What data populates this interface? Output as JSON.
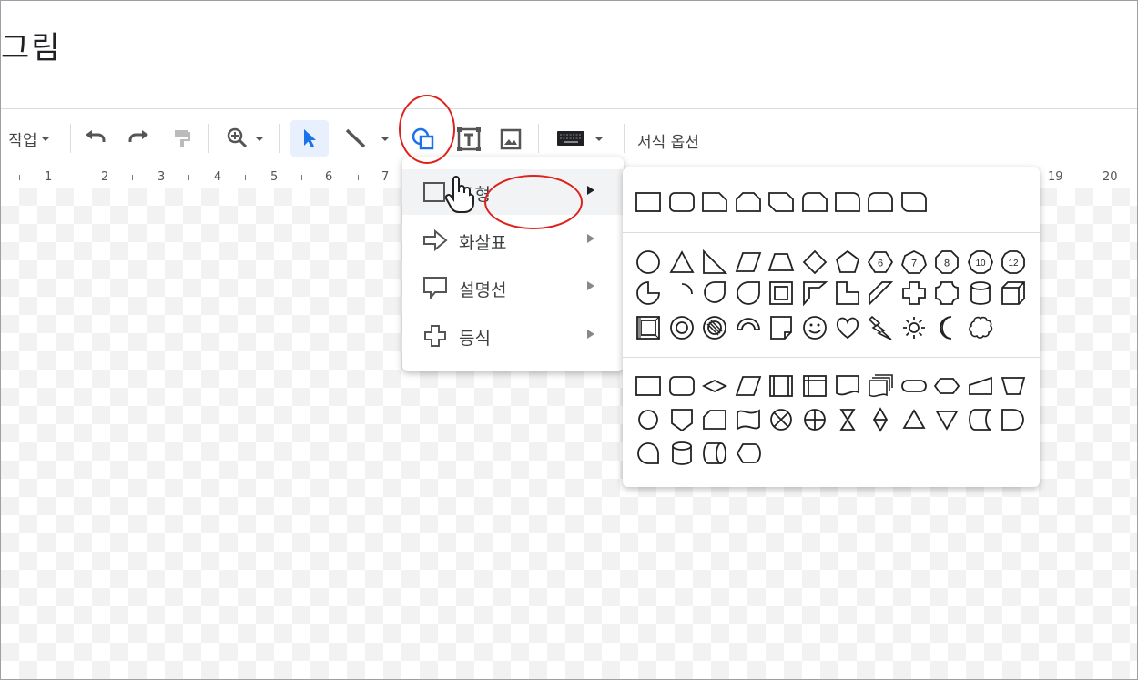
{
  "window": {
    "title": "그림"
  },
  "toolbar": {
    "actions_label": "작업",
    "undo_icon": "undo-icon",
    "redo_icon": "redo-icon",
    "paint_format_icon": "paint-format-icon",
    "zoom_icon": "zoom-icon",
    "select_icon": "cursor-icon",
    "line_icon": "line-icon",
    "shape_icon": "shape-icon",
    "textbox_icon": "textbox-icon",
    "image_icon": "image-icon",
    "input_tools_icon": "keyboard-icon",
    "format_options_label": "서식 옵션"
  },
  "ruler": {
    "numbers_left": [
      "1",
      "2",
      "3",
      "4",
      "5",
      "6",
      "7"
    ],
    "numbers_right": [
      "19",
      "20"
    ]
  },
  "shape_menu": {
    "items": [
      {
        "label": "도형",
        "icon": "square-icon",
        "active": true
      },
      {
        "label": "화살표",
        "icon": "arrow-icon",
        "active": false
      },
      {
        "label": "설명선",
        "icon": "callout-icon",
        "active": false
      },
      {
        "label": "등식",
        "icon": "plus-icon",
        "active": false
      }
    ]
  },
  "shapes_submenu": {
    "octagon_numbers": [
      "6",
      "7",
      "8",
      "10",
      "12"
    ]
  },
  "colors": {
    "accent": "#1a73e8",
    "annotation": "#e0211b",
    "active_bg": "#e8f0fe"
  }
}
